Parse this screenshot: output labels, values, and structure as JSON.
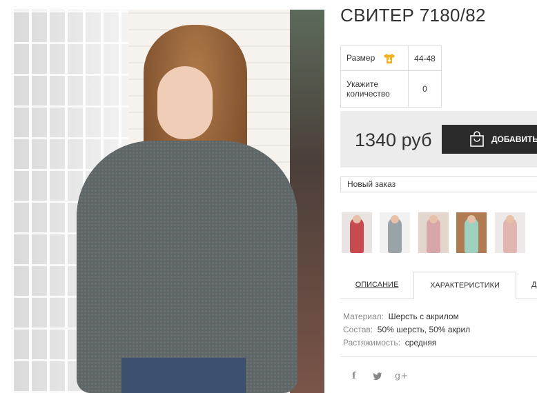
{
  "product": {
    "title": "СВИТЕР 7180/82"
  },
  "options": {
    "size_label": "Размер",
    "size_value": "44-48",
    "quantity_label": "Укажите количество",
    "quantity_value": "0"
  },
  "buy": {
    "price": "1340 руб",
    "add_label": "ДОБАВИТЬ В"
  },
  "order_select": {
    "selected": "Новый заказ"
  },
  "thumbnails": [
    {
      "name": "thumb-1",
      "color": "#e9e4e2",
      "figure": "#c74a4f"
    },
    {
      "name": "thumb-2",
      "color": "#f1f1f1",
      "figure": "#9aa3a8"
    },
    {
      "name": "thumb-3",
      "color": "#e4d6cc",
      "figure": "#d7a6a8"
    },
    {
      "name": "thumb-4",
      "color": "#b07a52",
      "figure": "#9ed1c0"
    },
    {
      "name": "thumb-5",
      "color": "#ece9e8",
      "figure": "#e2b6b0"
    }
  ],
  "tabs": [
    {
      "label": "ОПИСАНИЕ",
      "active": false
    },
    {
      "label": "ХАРАКТЕРИСТИКИ",
      "active": true
    },
    {
      "label": "Д",
      "active": false
    }
  ],
  "specs": [
    {
      "key": "Материал:",
      "value": "Шерсть с акрилом"
    },
    {
      "key": "Состав:",
      "value": "50% шерсть, 50% акрил"
    },
    {
      "key": "Растяжимость:",
      "value": "средняя"
    }
  ],
  "social": {
    "facebook": "f",
    "twitter": "twitter-icon",
    "google": "g+"
  },
  "colors": {
    "button_bg": "#2b2b2b",
    "buybox_bg": "#ececec",
    "size_icon": "#f2b01e"
  }
}
